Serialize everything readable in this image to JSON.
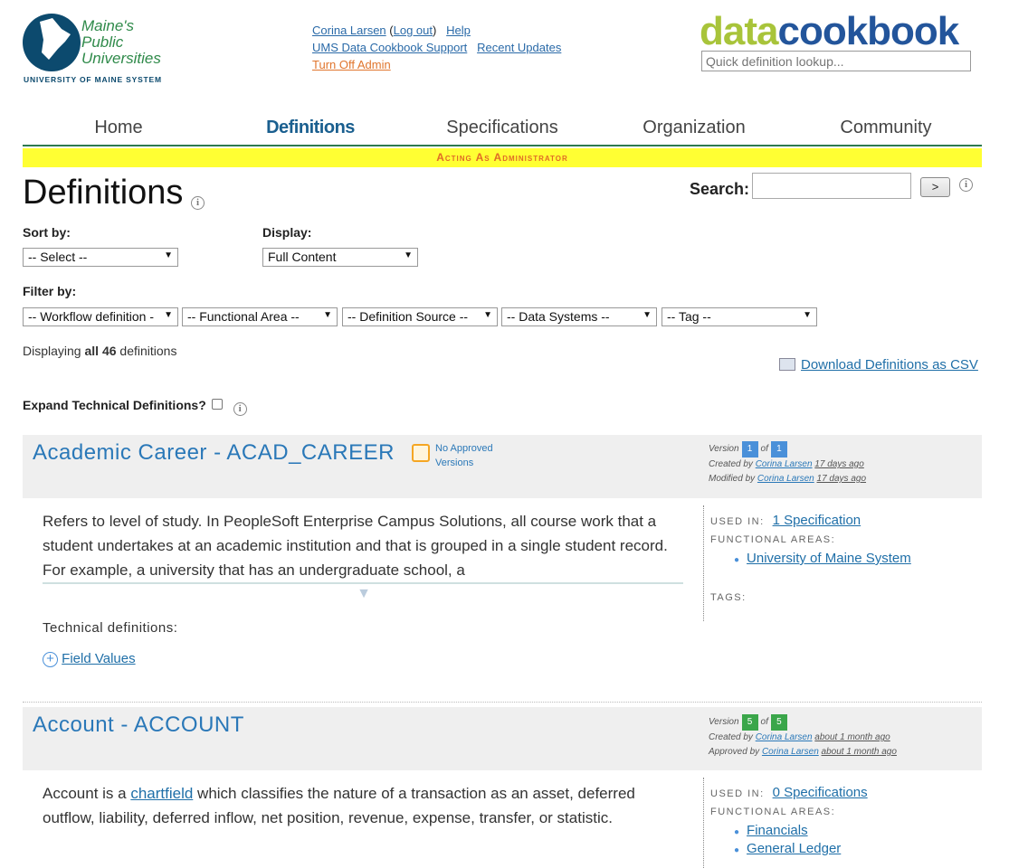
{
  "logo": {
    "line1": "Maine's",
    "line2": "Public",
    "line3": "Universities",
    "sub": "UNIVERSITY OF MAINE SYSTEM"
  },
  "header": {
    "user": "Corina Larsen",
    "logout": "Log out",
    "help": "Help",
    "support": "UMS Data Cookbook Support",
    "updates": "Recent Updates",
    "turn_off_admin": "Turn Off Admin",
    "brand_left": "data",
    "brand_right": "cookbook",
    "quick_placeholder": "Quick definition lookup..."
  },
  "nav": {
    "home": "Home",
    "definitions": "Definitions",
    "specifications": "Specifications",
    "organization": "Organization",
    "community": "Community"
  },
  "admin_bar": "Acting As Administrator",
  "page": {
    "title": "Definitions",
    "search_label": "Search:",
    "search_button": ">",
    "sort_label": "Sort by:",
    "sort_value": "-- Select --",
    "display_label": "Display:",
    "display_value": "Full Content",
    "filter_label": "Filter by:",
    "filters": [
      "-- Workflow definition -",
      "-- Functional Area --",
      "-- Definition Source --",
      "-- Data Systems --",
      "-- Tag --"
    ],
    "displaying_prefix": "Displaying ",
    "displaying_count": "all 46",
    "displaying_suffix": " definitions",
    "csv_link": "Download Definitions as CSV",
    "expand_label": "Expand Technical Definitions?"
  },
  "cards": [
    {
      "title": "Academic Career - ACAD_CAREER",
      "approval_1": "No Approved",
      "approval_2": "Versions",
      "version_label": "Version",
      "version": "1",
      "of": "of",
      "total": "1",
      "created_label": "Created by",
      "created_by": "Corina Larsen",
      "created_ago": "17 days ago",
      "modified_label": "Modified by",
      "modified_by": "Corina Larsen",
      "modified_ago": "17 days ago",
      "description": "Refers to level of study. In PeopleSoft Enterprise Campus Solutions, all course work that a student undertakes at an academic institution and that is grouped in a single student record. For example, a university that has an undergraduate school, a",
      "used_in_label": "USED IN:",
      "used_in": "1 Specification",
      "areas_label": "FUNCTIONAL AREAS:",
      "areas": [
        "University of Maine System"
      ],
      "tags_label": "TAGS:",
      "tech_label": "Technical definitions:",
      "field_values": "Field Values"
    },
    {
      "title": "Account - ACCOUNT",
      "version_label": "Version",
      "version": "5",
      "of": "of",
      "total": "5",
      "created_label": "Created by",
      "created_by": "Corina Larsen",
      "created_ago": "about 1 month ago",
      "approved_label": "Approved by",
      "approved_by": "Corina Larsen",
      "approved_ago": "about 1 month ago",
      "desc_prefix": "Account is a ",
      "desc_link": "chartfield",
      "desc_suffix": " which classifies the nature of a transaction as an asset, deferred outflow, liability, deferred inflow, net position, revenue, expense, transfer, or statistic.",
      "used_in_label": "USED IN:",
      "used_in": "0 Specifications",
      "areas_label": "FUNCTIONAL AREAS:",
      "areas": [
        "Financials",
        "General Ledger"
      ]
    }
  ],
  "colors": {
    "nav_active": "#1a5f8f",
    "admin_bar": "#ffff33",
    "link": "#2a78b8",
    "version_blue": "#4a90d9",
    "version_green": "#3aa64a"
  }
}
